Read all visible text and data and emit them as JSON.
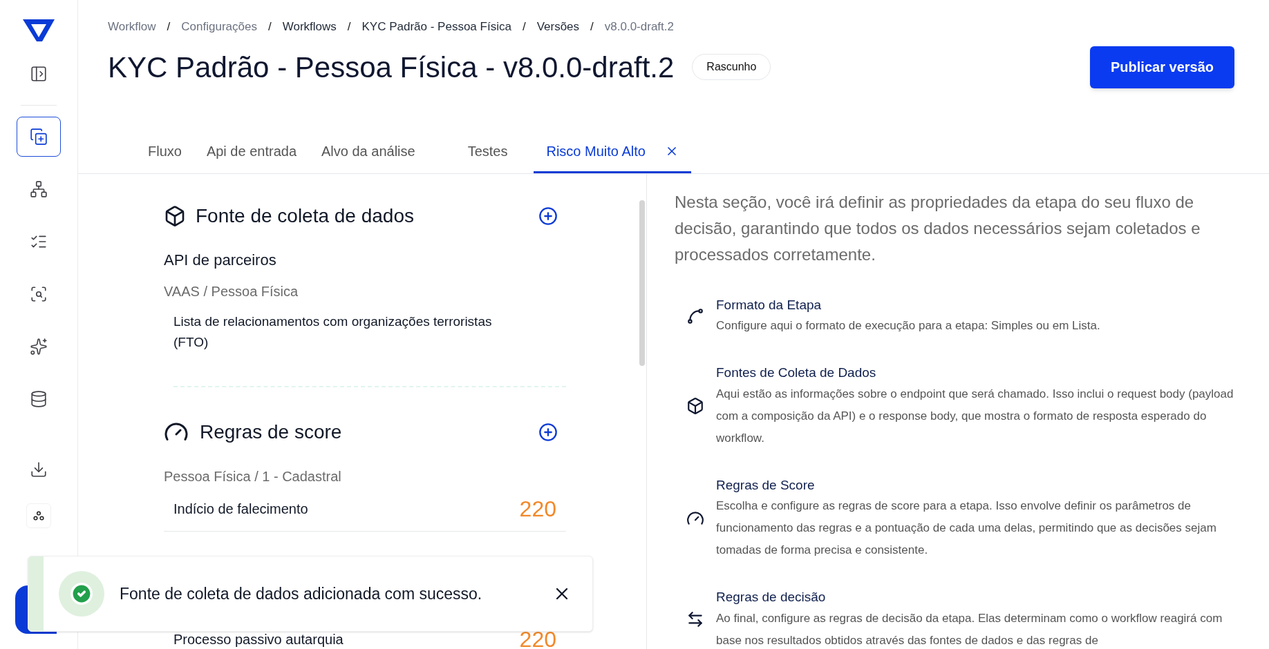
{
  "sidebar": {
    "items": [
      {
        "kind": "panel",
        "selected": false
      },
      {
        "kind": "add",
        "selected": true
      },
      {
        "kind": "network",
        "selected": false
      },
      {
        "kind": "checklist",
        "selected": false
      },
      {
        "kind": "inspect",
        "selected": false
      },
      {
        "kind": "sparkles",
        "selected": false
      },
      {
        "kind": "database",
        "selected": false
      },
      {
        "kind": "download",
        "selected": false
      },
      {
        "kind": "dots",
        "selected": false
      }
    ]
  },
  "breadcrumb": [
    {
      "label": "Workflow",
      "muted": true
    },
    {
      "label": "Configurações",
      "muted": true
    },
    {
      "label": "Workflows",
      "muted": false
    },
    {
      "label": "KYC Padrão - Pessoa Física",
      "muted": false
    },
    {
      "label": "Versões",
      "muted": false
    },
    {
      "label": "v8.0.0-draft.2",
      "muted": true
    }
  ],
  "separator": "/",
  "title": "KYC Padrão - Pessoa Física - v8.0.0-draft.2",
  "status_badge": "Rascunho",
  "publish_button": "Publicar versão",
  "tabs": [
    {
      "label": "Fluxo",
      "selected": false,
      "closable": false
    },
    {
      "label": "Api de entrada",
      "selected": false,
      "closable": false
    },
    {
      "label": "Alvo da análise",
      "selected": false,
      "closable": false
    },
    {
      "label": "Testes",
      "selected": false,
      "closable": false
    },
    {
      "label": "Risco Muito Alto",
      "selected": true,
      "closable": true
    }
  ],
  "sources_section": {
    "title": "Fonte de coleta de dados",
    "source": {
      "name": "API de parceiros",
      "path": "VAAS / Pessoa Física",
      "items": [
        "Lista de relacionamentos com organizações terroristas (FTO)"
      ]
    }
  },
  "score_section": {
    "title": "Regras de score",
    "group": "Pessoa Física / 1 - Cadastral",
    "rules": [
      {
        "name": "Indício de falecimento",
        "score": "220"
      },
      {
        "name": "Processo passivo autarquia",
        "score": "220"
      }
    ]
  },
  "help": {
    "intro": "Nesta seção, você irá definir as propriedades da etapa do seu fluxo de decisão, garantindo que todos os dados necessários sejam coletados e processados corretamente.",
    "items": [
      {
        "kind": "format",
        "title": "Formato da Etapa",
        "description": "Configure aqui o formato de execução para a etapa: Simples ou em Lista."
      },
      {
        "kind": "sources",
        "title": "Fontes de Coleta de Dados",
        "description": "Aqui estão as informações sobre o endpoint que será chamado. Isso inclui o request body (payload com a composição da API) e o response body, que mostra o formato de resposta esperado do workflow."
      },
      {
        "kind": "score",
        "title": "Regras de Score",
        "description": "Escolha e configure as regras de score para a etapa. Isso envolve definir os parâmetros de funcionamento das regras e a pontuação de cada uma delas, permitindo que as decisões sejam tomadas de forma precisa e consistente."
      },
      {
        "kind": "decision",
        "title": "Regras de decisão",
        "description": "Ao final, configure as regras de decisão da etapa. Elas determinam como o workflow reagirá com base nos resultados obtidos através das fontes de dados e das regras de"
      }
    ]
  },
  "toast": {
    "kind": "success",
    "message": "Fonte de coleta de dados adicionada com sucesso."
  }
}
